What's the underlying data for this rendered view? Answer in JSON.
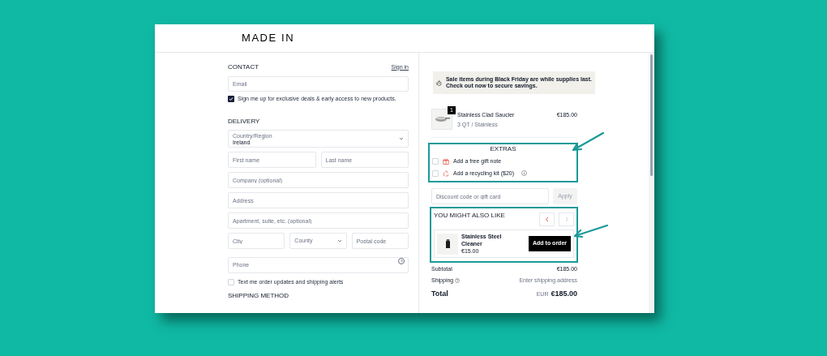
{
  "brand": "MADE IN",
  "contact": {
    "heading": "CONTACT",
    "sign_in": "Sign in",
    "email": {
      "placeholder": "Email"
    },
    "marketing": {
      "label": "Sign me up for exclusive deals & early access to new products.",
      "checked": true
    }
  },
  "delivery": {
    "heading": "DELIVERY",
    "country": {
      "label": "Country/Region",
      "value": "Ireland"
    },
    "rows": [
      [
        {
          "kind": "text",
          "placeholder": "First name"
        },
        {
          "kind": "text",
          "placeholder": "Last name"
        }
      ],
      [
        {
          "kind": "text",
          "placeholder": "Company (optional)"
        }
      ],
      [
        {
          "kind": "text",
          "placeholder": "Address"
        }
      ],
      [
        {
          "kind": "text",
          "placeholder": "Apartment, suite, etc. (optional)"
        }
      ],
      [
        {
          "kind": "text",
          "placeholder": "City"
        },
        {
          "kind": "select",
          "placeholder": "County"
        },
        {
          "kind": "text",
          "placeholder": "Postal code"
        }
      ],
      [
        {
          "kind": "help",
          "placeholder": "Phone"
        }
      ]
    ],
    "sms": {
      "label": "Text me order updates and shipping alerts",
      "checked": false
    }
  },
  "shipping_method": {
    "heading": "SHIPPING METHOD"
  },
  "notice": {
    "lines": [
      "Sale items during Black Friday are while supplies last.",
      "Check out now to secure savings."
    ]
  },
  "cart": [
    {
      "name": "Stainless Clad Saucier",
      "variant": "3 QT / Stainless",
      "price": "€185.00",
      "quantity": "1"
    }
  ],
  "extras": {
    "heading": "EXTRAS",
    "items": [
      {
        "label": "Add a free gift note",
        "checked": false,
        "info": false,
        "kind": "gift"
      },
      {
        "label": "Add a recycling kit ($20)",
        "checked": false,
        "info": true,
        "kind": "recycle"
      }
    ]
  },
  "discount": {
    "placeholder": "Discount code or gift card",
    "button": "Apply"
  },
  "upsell": {
    "heading": "YOU MIGHT ALSO LIKE",
    "prev_disabled": false,
    "next_disabled": true,
    "product": {
      "name": "Stainless Steel Cleaner",
      "price": "€15.00",
      "button": "Add to order"
    }
  },
  "summary": {
    "subtotal": {
      "label": "Subtotal",
      "value": "€185.00"
    },
    "shipping": {
      "label": "Shipping",
      "value": "Enter shipping address"
    },
    "total": {
      "label": "Total",
      "currency": "EUR",
      "value": "€185.00"
    }
  }
}
